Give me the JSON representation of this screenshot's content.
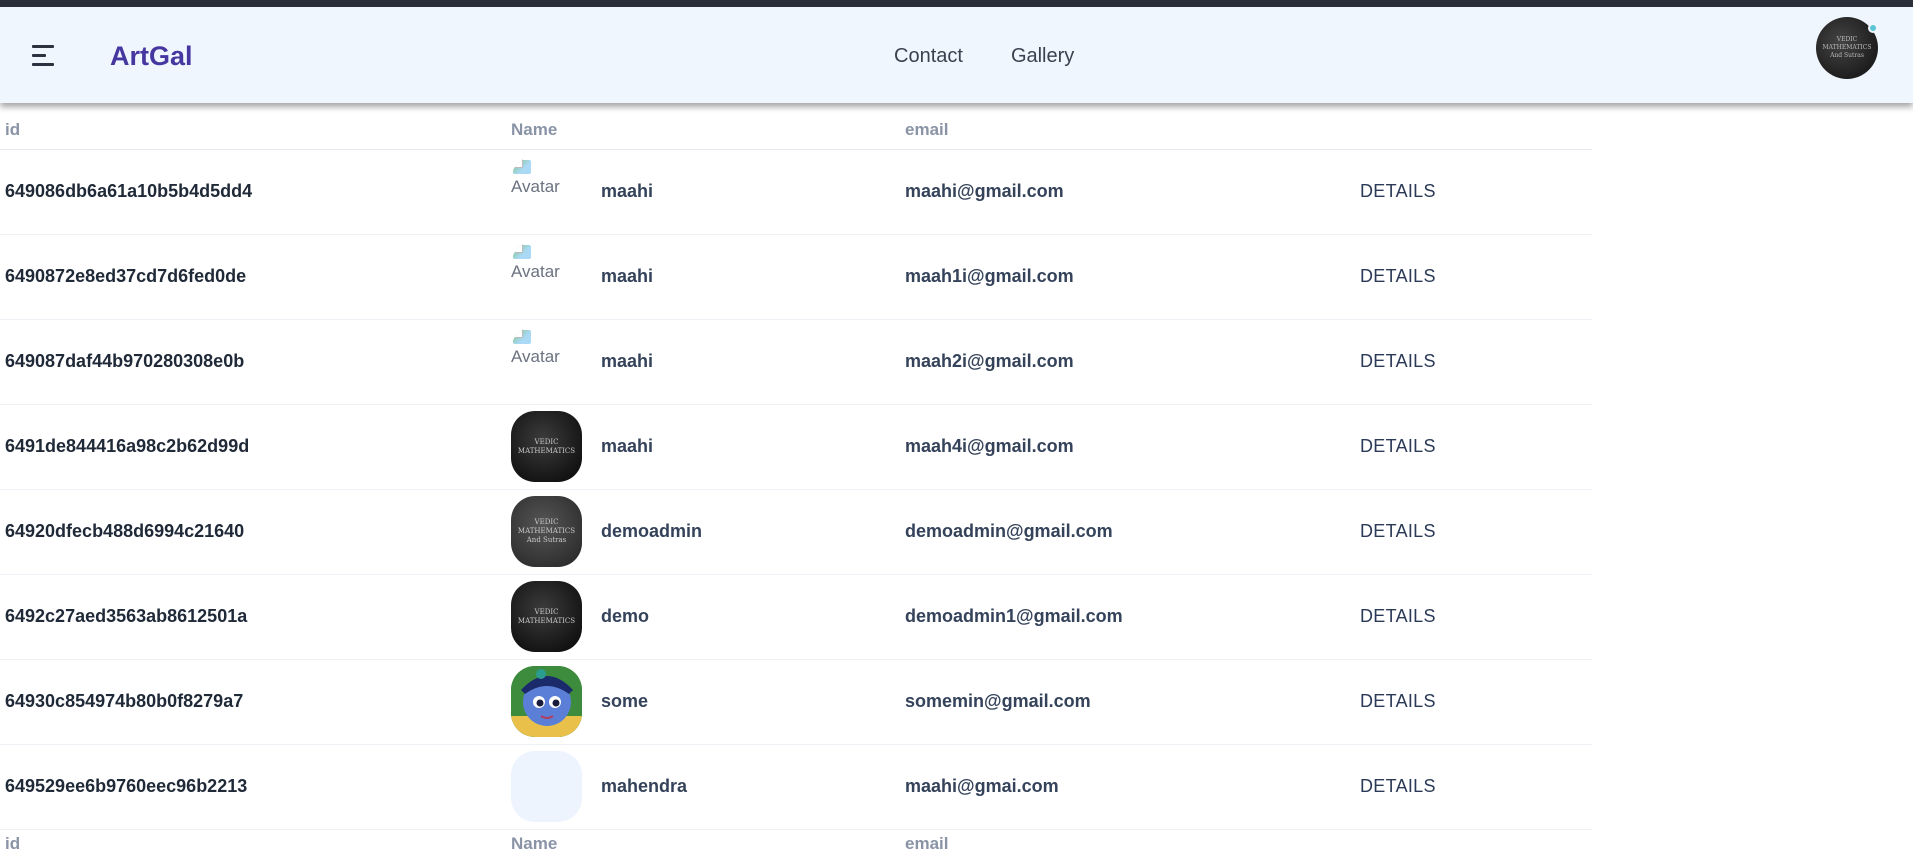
{
  "navbar": {
    "brand": "ArtGal",
    "links": [
      "Contact",
      "Gallery"
    ],
    "profile_text": [
      "VEDIC",
      "MATHEMATICS",
      "And Sutras"
    ]
  },
  "table": {
    "headers": {
      "id": "id",
      "name": "Name",
      "email": "email"
    },
    "rows": [
      {
        "id": "649086db6a61a10b5b4d5dd4",
        "avatar": "broken",
        "avatar_alt": "Avatar",
        "name": "maahi",
        "email": "maahi@gmail.com",
        "action": "DETAILS"
      },
      {
        "id": "6490872e8ed37cd7d6fed0de",
        "avatar": "broken",
        "avatar_alt": "Avatar",
        "name": "maahi",
        "email": "maah1i@gmail.com",
        "action": "DETAILS"
      },
      {
        "id": "649087daf44b970280308e0b",
        "avatar": "broken",
        "avatar_alt": "Avatar",
        "name": "maahi",
        "email": "maah2i@gmail.com",
        "action": "DETAILS"
      },
      {
        "id": "6491de844416a98c2b62d99d",
        "avatar": "vedic-dark",
        "avatar_text": [
          "VEDIC",
          "MATHEMATICS"
        ],
        "name": "maahi",
        "email": "maah4i@gmail.com",
        "action": "DETAILS"
      },
      {
        "id": "64920dfecb488d6994c21640",
        "avatar": "vedic-grey",
        "avatar_text": [
          "VEDIC",
          "MATHEMATICS",
          "And Sutras"
        ],
        "name": "demoadmin",
        "email": "demoadmin@gmail.com",
        "action": "DETAILS"
      },
      {
        "id": "6492c27aed3563ab8612501a",
        "avatar": "vedic-dark",
        "avatar_text": [
          "VEDIC",
          "MATHEMATICS"
        ],
        "name": "demo",
        "email": "demoadmin1@gmail.com",
        "action": "DETAILS"
      },
      {
        "id": "64930c854974b80b0f8279a7",
        "avatar": "krishna",
        "name": "some",
        "email": "somemin@gmail.com",
        "action": "DETAILS"
      },
      {
        "id": "649529ee6b9760eec96b2213",
        "avatar": "empty",
        "name": "mahendra",
        "email": "maahi@gmai.com",
        "action": "DETAILS"
      }
    ]
  },
  "footer_headers": {
    "id": "id",
    "name": "Name",
    "email": "email"
  },
  "colors": {
    "brand": "#4637a0",
    "navbar_bg": "#f0f6fe",
    "header_text": "#8a94a6"
  }
}
